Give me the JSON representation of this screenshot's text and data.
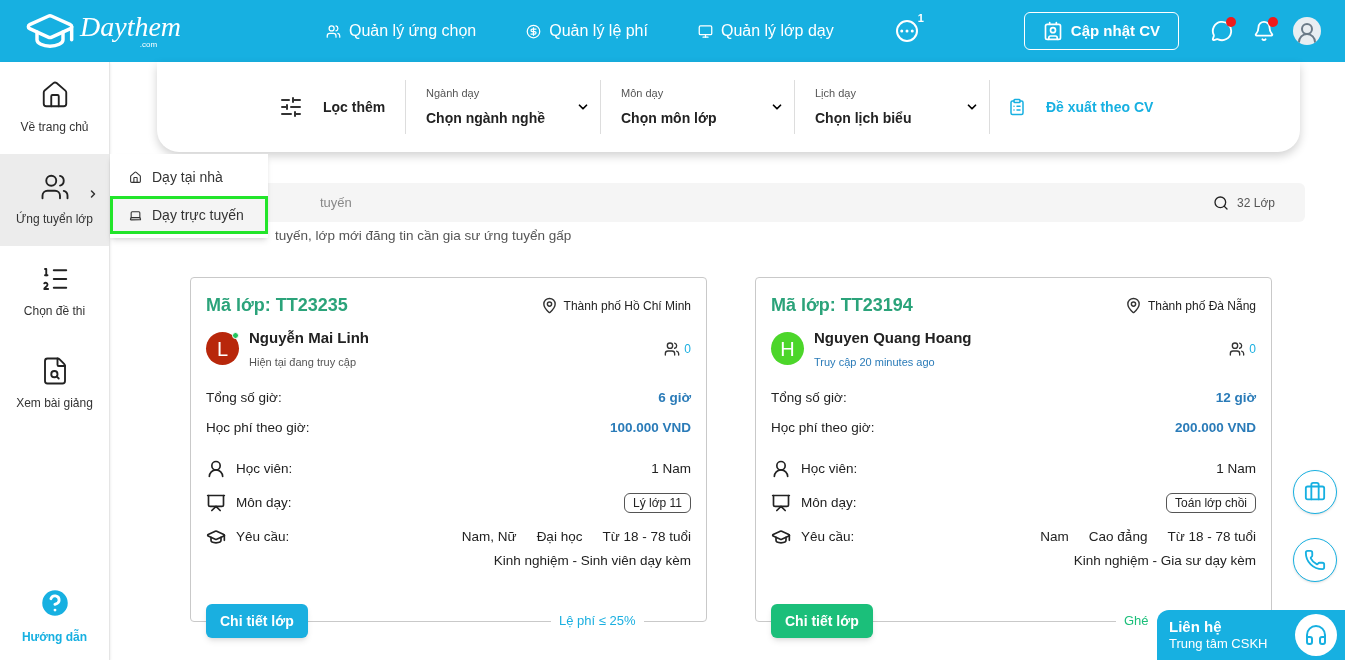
{
  "header": {
    "logo": "Daythem",
    "logo_suffix": ".com",
    "nav": [
      {
        "label": "Quản lý ứng chọn",
        "kind": "people"
      },
      {
        "label": "Quản lý lệ phí",
        "kind": "fee"
      },
      {
        "label": "Quản lý lớp dạy",
        "kind": "screen"
      }
    ],
    "more_badge": "1",
    "cv_button": "Cập nhật CV",
    "chat_unread": true,
    "bell_unread": true
  },
  "sidebar": {
    "items": [
      {
        "label": "Về trang chủ",
        "kind": "home",
        "selected": false,
        "has_submenu": false
      },
      {
        "label": "Ứng tuyển lớp",
        "kind": "class",
        "selected": true,
        "has_submenu": true
      },
      {
        "label": "Chọn đề thi",
        "kind": "abc",
        "selected": false,
        "has_submenu": false
      },
      {
        "label": "Xem bài giảng",
        "kind": "lecture",
        "selected": false,
        "has_submenu": false
      }
    ],
    "help": "Hướng dẫn"
  },
  "submenu": {
    "items": [
      {
        "label": "Dạy tại nhà",
        "kind": "home",
        "selected": false
      },
      {
        "label": "Dạy trực tuyến",
        "kind": "laptop",
        "selected": true
      }
    ]
  },
  "filter": {
    "title": "Lọc thêm",
    "dropdowns": [
      {
        "label": "Ngành dạy",
        "value": "Chọn ngành nghề"
      },
      {
        "label": "Môn dạy",
        "value": "Chọn môn lớp"
      },
      {
        "label": "Lịch dạy",
        "value": "Chọn lịch biểu"
      }
    ],
    "suggest": "Đề xuất theo CV"
  },
  "search": {
    "placeholder": "tuyến",
    "count": "32 Lớp"
  },
  "subtitle": "tuyến, lớp mới đăng tin cần gia sư ứng tuyển gấp",
  "cards": [
    {
      "code": "Mã lớp: TT23235",
      "city": "Thành phố Hồ Chí Minh",
      "tutor": {
        "initial": "L",
        "name": "Nguyễn Mai Linh",
        "status": "Hiện tại đang truy cập",
        "online": true,
        "color": "#b8270b"
      },
      "applicants": "0",
      "hours_label": "Tổng số giờ:",
      "hours": "6 giờ",
      "fee_label": "Học phí theo giờ:",
      "fee": "100.000 VND",
      "students_label": "Học viên:",
      "students": "1 Nam",
      "subject_label": "Môn dạy:",
      "subject": "Lý lớp 11",
      "req_label": "Yêu cầu:",
      "requirements": [
        "Nam, Nữ",
        "Đại học",
        "Từ 18 - 78 tuổi"
      ],
      "experience": "Kinh nghiệm - Sinh viên dạy kèm",
      "button": "Chi tiết lớp",
      "color": "#1aafe0",
      "note": "Lệ phí ≤ 25%"
    },
    {
      "code": "Mã lớp: TT23194",
      "city": "Thành phố Đà Nẵng",
      "tutor": {
        "initial": "H",
        "name": "Nguyen Quang Hoang",
        "status": "Truy cập 20 minutes ago",
        "online": false,
        "color": "#4cd62a"
      },
      "applicants": "0",
      "hours_label": "Tổng số giờ:",
      "hours": "12 giờ",
      "fee_label": "Học phí theo giờ:",
      "fee": "200.000 VND",
      "students_label": "Học viên:",
      "students": "1 Nam",
      "subject_label": "Môn dạy:",
      "subject": "Toán lớp chồi",
      "req_label": "Yêu cầu:",
      "requirements": [
        "Nam",
        "Cao đẳng",
        "Từ 18 - 78 tuổi"
      ],
      "experience": "Kinh nghiệm - Gia sư dạy kèm",
      "button": "Chi tiết lớp",
      "color": "#1bbf7a",
      "note": "Ghé"
    }
  ],
  "contact": {
    "title": "Liên hệ",
    "subtitle": "Trung tâm CSKH"
  }
}
